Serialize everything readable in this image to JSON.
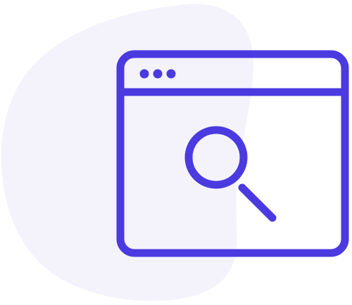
{
  "illustration": {
    "subject": "browser-window-with-search",
    "icon": "search-icon",
    "window_control_icons": [
      "dot-icon",
      "dot-icon",
      "dot-icon"
    ],
    "colors": {
      "stroke": "#4A3AE0",
      "blob": "#F4F3FC",
      "window_fill": "#FFFFFF",
      "background": "#FFFFFF"
    }
  }
}
